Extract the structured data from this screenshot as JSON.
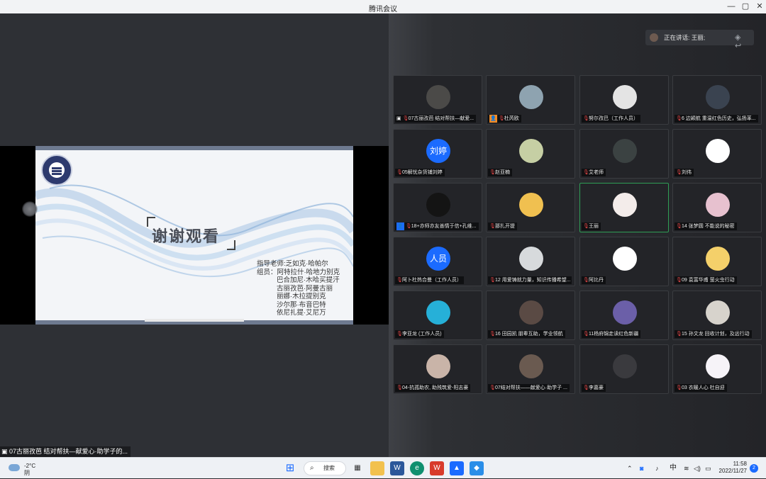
{
  "window": {
    "title": "腾讯会议",
    "controls": [
      "—",
      "▢",
      "✕"
    ]
  },
  "slide": {
    "title": "谢谢观看",
    "credits": [
      "指导老师:乏如克·哈帕尔",
      "组员：阿特拉什·哈地力别克",
      "巴合加尼·木哈买提汗",
      "古丽孜芭·阿曼古丽",
      "丽娜·木拉提别克",
      "沙尔那·布音巴特",
      "依尼扎提·艾尼万"
    ]
  },
  "left_caption": "07古丽孜芭 结对帮扶—献爱心·助学子的...",
  "speaking": {
    "label": "正在讲话: 王丽;",
    "icon": "speaker-icon"
  },
  "participants": [
    {
      "name": "07古丽孜芭 结对帮扶—献爱...",
      "avatar": "#4b4a48",
      "share": true
    },
    {
      "name": "杜芮欧",
      "avatar": "#8ea3b0",
      "badge": "person"
    },
    {
      "name": "努尔孜巴（工作人员）",
      "avatar": "#e4e4e4"
    },
    {
      "name": "6 边颖航 重温红色历史，弘扬革...",
      "avatar": "#3a4350"
    },
    {
      "name": "05解忧杂货铺刘婷",
      "avatar": "#1b6bff",
      "text": "刘婷"
    },
    {
      "name": "赵亚楠",
      "avatar": "#c6cfa4"
    },
    {
      "name": "艾老师",
      "avatar": "#3b4242"
    },
    {
      "name": "刘伟",
      "avatar": "#ffffff"
    },
    {
      "name": "18+亦师亦友善情于信+孔维...",
      "avatar": "#141414",
      "badge": "person-blue"
    },
    {
      "name": "那扎开提",
      "avatar": "#f0c050"
    },
    {
      "name": "王丽",
      "avatar": "#f3ecea",
      "speaking": true
    },
    {
      "name": "14 张梦圆 不能说的秘密",
      "avatar": "#e7c1cf"
    },
    {
      "name": "阿卜杜热合曼（工作人员）",
      "avatar": "#1b6bff",
      "text": "人员"
    },
    {
      "name": "12 用爱铸就力量，知识传播希望...",
      "avatar": "#d7dadc"
    },
    {
      "name": "阿比丹",
      "avatar": "#ffffff"
    },
    {
      "name": "09 袁富华甫 萤火虫行动",
      "avatar": "#f4d06a"
    },
    {
      "name": "李亚龙 (工作人员)",
      "avatar": "#26b0d8"
    },
    {
      "name": "16 田园凯 朋辈互助，学业领航",
      "avatar": "#5a4a44"
    },
    {
      "name": "11杨府锦走读红色新疆",
      "avatar": "#6b5fa8"
    },
    {
      "name": "15 孙文龙 回收计划，及远行动",
      "avatar": "#d7d3cc"
    },
    {
      "name": "04-抗孤助农, 助残筑爱-阳志豪",
      "avatar": "#c9b4a8"
    },
    {
      "name": "07结对帮扶——献爱心·助学子 ...",
      "avatar": "#6a5a50"
    },
    {
      "name": "李嘉豪",
      "avatar": "#3a3a3e"
    },
    {
      "name": "03 衣暖人心 杜自迎",
      "avatar": "#f6f3f8"
    }
  ],
  "taskbar": {
    "weather_temp": "-2°C",
    "weather_desc": "阴",
    "search": "搜索",
    "time": "11:58",
    "date": "2022/11/27",
    "ime": "中",
    "notifications": "2"
  }
}
